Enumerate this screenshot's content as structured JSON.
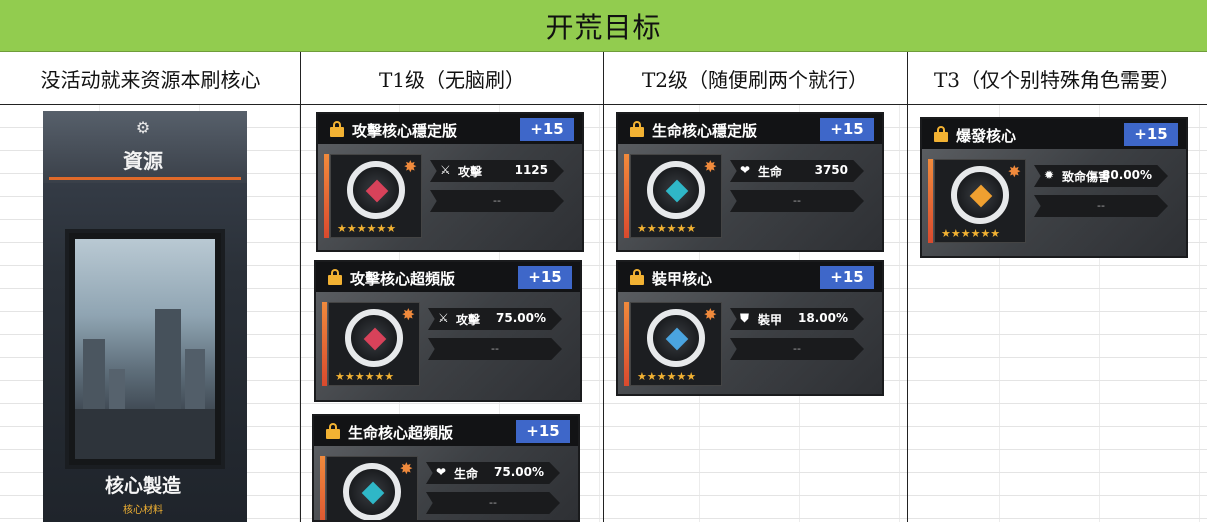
{
  "title": "开荒目标",
  "columns": [
    {
      "label": "没活动就来资源本刷核心"
    },
    {
      "label": "T1级（无脑刷）"
    },
    {
      "label": "T2级（随便刷两个就行）"
    },
    {
      "label": "T3（仅个别特殊角色需要）"
    }
  ],
  "resource_panel": {
    "title": "資源",
    "name": "核心製造",
    "subtitle": "核心材料"
  },
  "cards": [
    {
      "name": "攻擊核心穩定版",
      "level": "+15",
      "stat_icon": "⚔",
      "stat_label": "攻擊",
      "stat_value": "1125",
      "secondary": "--",
      "stars": "★★★★★★",
      "gem_color": "#d8425a"
    },
    {
      "name": "攻擊核心超頻版",
      "level": "+15",
      "stat_icon": "⚔",
      "stat_label": "攻擊",
      "stat_value": "75.00%",
      "secondary": "--",
      "stars": "★★★★★★",
      "gem_color": "#d8425a"
    },
    {
      "name": "生命核心超頻版",
      "level": "+15",
      "stat_icon": "❤",
      "stat_label": "生命",
      "stat_value": "75.00%",
      "secondary": "--",
      "stars": "★★★★★★",
      "gem_color": "#2fb7c7"
    },
    {
      "name": "生命核心穩定版",
      "level": "+15",
      "stat_icon": "❤",
      "stat_label": "生命",
      "stat_value": "3750",
      "secondary": "--",
      "stars": "★★★★★★",
      "gem_color": "#2fb7c7"
    },
    {
      "name": "裝甲核心",
      "level": "+15",
      "stat_icon": "⛊",
      "stat_label": "裝甲",
      "stat_value": "18.00%",
      "secondary": "--",
      "stars": "★★★★★★",
      "gem_color": "#4aa4e0"
    },
    {
      "name": "爆發核心",
      "level": "+15",
      "stat_icon": "✹",
      "stat_label": "致命傷害",
      "stat_value": "80.00%",
      "secondary": "--",
      "stars": "★★★★★★",
      "gem_color": "#f0a030"
    }
  ]
}
